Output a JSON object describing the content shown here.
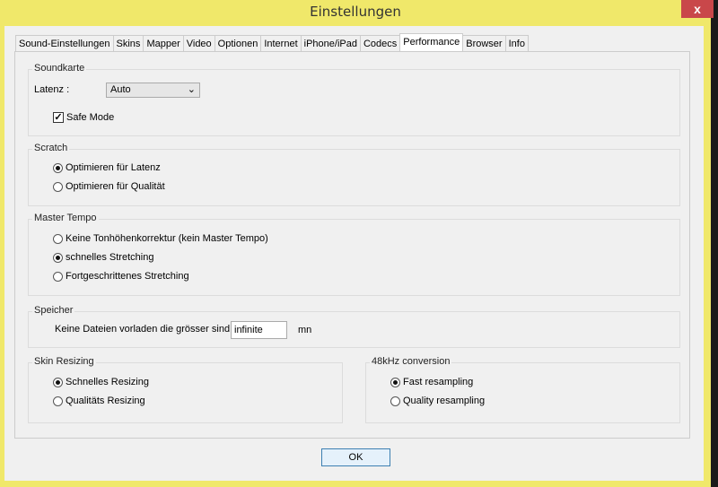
{
  "window": {
    "title": "Einstellungen",
    "close": "x"
  },
  "tabs": [
    "Sound-Einstellungen",
    "Skins",
    "Mapper",
    "Video",
    "Optionen",
    "Internet",
    "iPhone/iPad",
    "Codecs",
    "Performance",
    "Browser",
    "Info"
  ],
  "active_tab": "Performance",
  "soundkarte": {
    "label": "Soundkarte",
    "latenz_label": "Latenz :",
    "latenz_value": "Auto",
    "safe_mode": "Safe Mode",
    "safe_mode_checked": true
  },
  "scratch": {
    "label": "Scratch",
    "options": [
      "Optimieren für Latenz",
      "Optimieren für Qualität"
    ],
    "selected": 0
  },
  "master_tempo": {
    "label": "Master Tempo",
    "options": [
      "Keine Tonhöhenkorrektur (kein Master Tempo)",
      "schnelles Stretching",
      "Fortgeschrittenes Stretching"
    ],
    "selected": 1
  },
  "speicher": {
    "label": "Speicher",
    "text": "Keine Dateien vorladen die grösser sind",
    "value": "infinite",
    "unit": "mn"
  },
  "skin_resizing": {
    "label": "Skin Resizing",
    "options": [
      "Schnelles Resizing",
      "Qualitäts Resizing"
    ],
    "selected": 0
  },
  "conversion": {
    "label": "48kHz conversion",
    "options": [
      "Fast resampling",
      "Quality resampling"
    ],
    "selected": 0
  },
  "ok_label": "OK"
}
